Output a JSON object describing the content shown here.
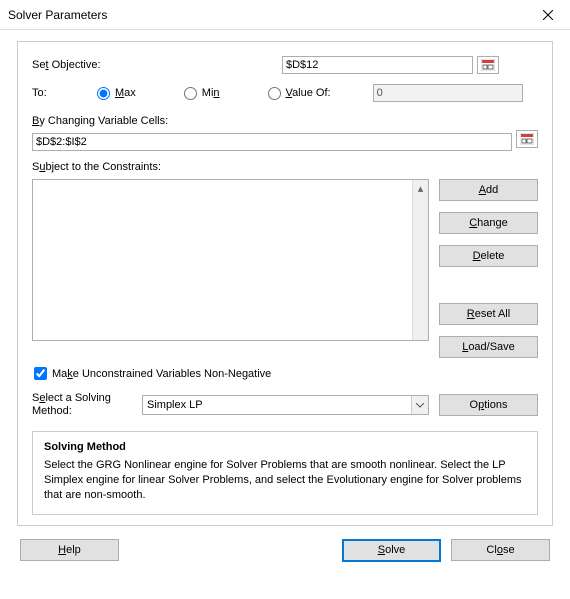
{
  "title": "Solver Parameters",
  "objective": {
    "label_pre": "Se",
    "label_u": "t",
    "label_post": " Objective:",
    "value": "$D$12"
  },
  "to": {
    "label": "To:",
    "max": {
      "u": "M",
      "post": "ax"
    },
    "min": {
      "pre": "Mi",
      "u": "n"
    },
    "valueof": {
      "u": "V",
      "post": "alue Of:"
    },
    "valueof_value": "0",
    "selected": "max"
  },
  "bycells": {
    "u": "B",
    "post": "y Changing Variable Cells:",
    "value": "$D$2:$I$2"
  },
  "constraints": {
    "label_pre": "S",
    "label_u": "u",
    "label_post": "bject to the Constraints:",
    "items": []
  },
  "buttons": {
    "add": {
      "u": "A",
      "post": "dd"
    },
    "change": {
      "u": "C",
      "post": "hange"
    },
    "delete": {
      "u": "D",
      "post": "elete"
    },
    "resetall": {
      "u": "R",
      "post": "eset All"
    },
    "loadsave": {
      "u": "L",
      "post": "oad/Save"
    },
    "options": {
      "pre": "O",
      "u": "p",
      "post": "tions"
    },
    "help": {
      "u": "H",
      "post": "elp"
    },
    "solve": {
      "u": "S",
      "post": "olve"
    },
    "close": {
      "pre": "Cl",
      "u": "o",
      "post": "se"
    }
  },
  "chk": {
    "pre": "Ma",
    "u": "k",
    "post": "e Unconstrained Variables Non-Negative",
    "checked": true
  },
  "method": {
    "label_pre": "S",
    "label_u": "e",
    "label_post": "lect a Solving Method:",
    "value": "Simplex LP"
  },
  "desc": {
    "title": "Solving Method",
    "text": "Select the GRG Nonlinear engine for Solver Problems that are smooth nonlinear. Select the LP Simplex engine for linear Solver Problems, and select the Evolutionary engine for Solver problems that are non-smooth."
  }
}
